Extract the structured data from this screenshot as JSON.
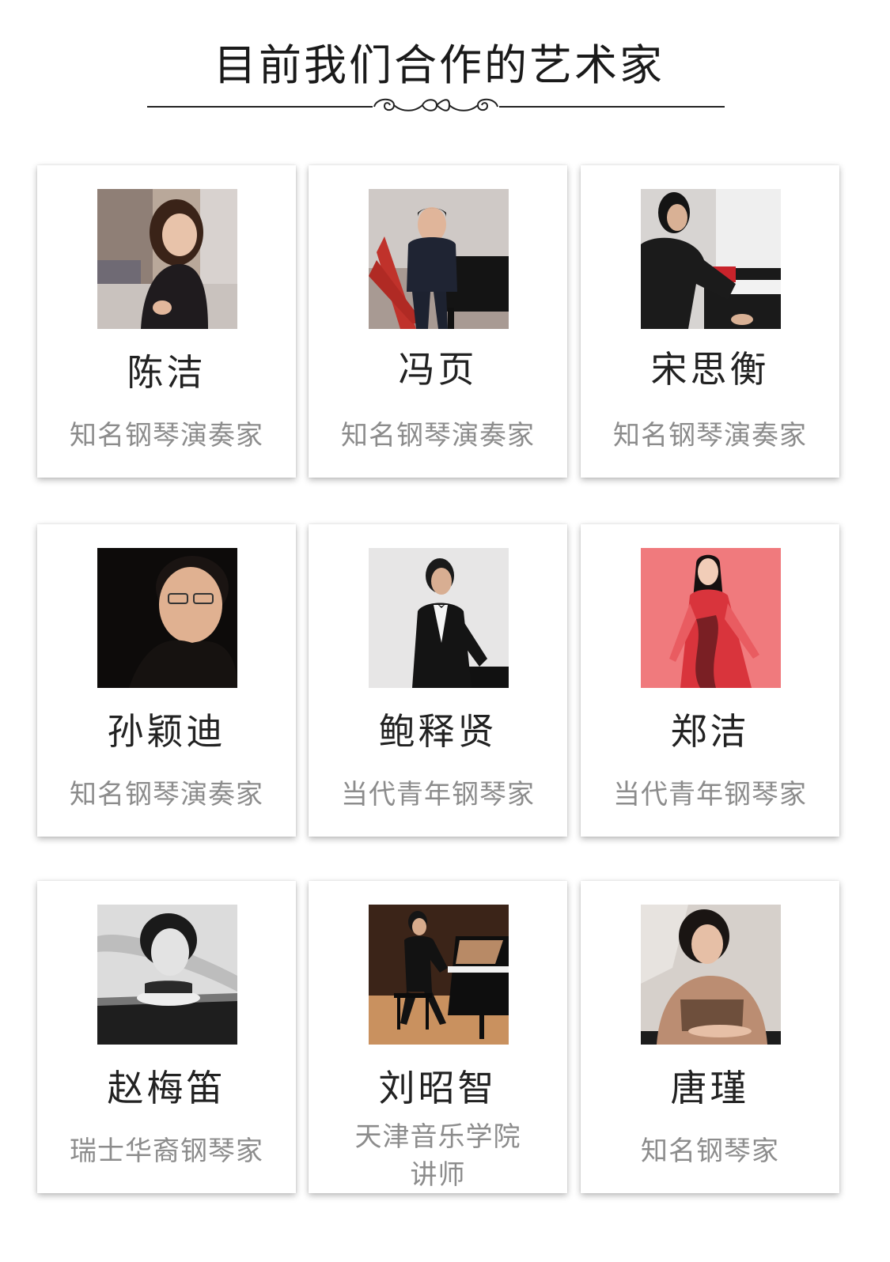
{
  "page": {
    "title": "目前我们合作的艺术家"
  },
  "artists": [
    {
      "name": "陈洁",
      "role": "知名钢琴演奏家",
      "photo_icon": "portrait-woman-city"
    },
    {
      "name": "冯页",
      "role": "知名钢琴演奏家",
      "photo_icon": "portrait-man-piano"
    },
    {
      "name": "宋思衡",
      "role": "知名钢琴演奏家",
      "photo_icon": "portrait-man-playing-piano"
    },
    {
      "name": "孙颖迪",
      "role": "知名钢琴演奏家",
      "photo_icon": "portrait-man-glasses"
    },
    {
      "name": "鲍释贤",
      "role": "当代青年钢琴家",
      "photo_icon": "portrait-man-tuxedo"
    },
    {
      "name": "郑洁",
      "role": "当代青年钢琴家",
      "photo_icon": "portrait-woman-pink"
    },
    {
      "name": "赵梅笛",
      "role": "瑞士华裔钢琴家",
      "photo_icon": "portrait-woman-bw"
    },
    {
      "name": "刘昭智",
      "role_line1": "天津音乐学院",
      "role_line2": "讲师",
      "photo_icon": "portrait-man-stage-piano"
    },
    {
      "name": "唐瑾",
      "role": "知名钢琴家",
      "photo_icon": "portrait-woman-piano"
    }
  ]
}
